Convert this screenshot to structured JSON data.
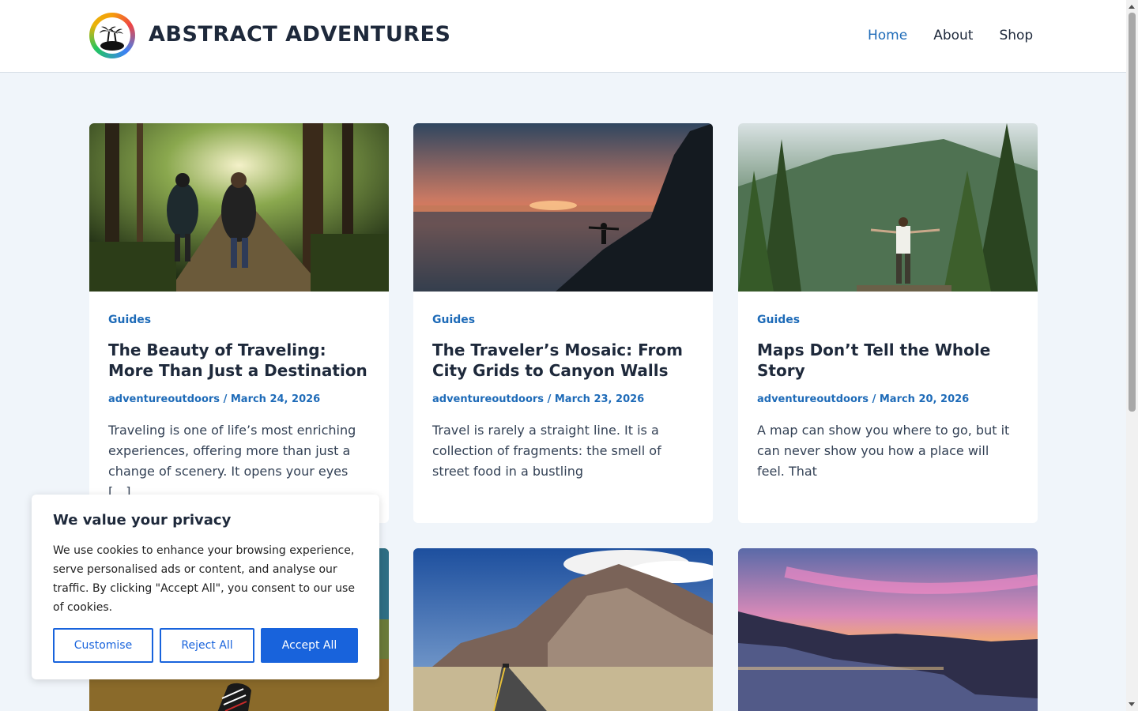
{
  "header": {
    "site_title": "ABSTRACT ADVENTURES",
    "nav": [
      {
        "label": "Home",
        "active": true
      },
      {
        "label": "About",
        "active": false
      },
      {
        "label": "Shop",
        "active": false
      }
    ]
  },
  "posts": [
    {
      "category": "Guides",
      "title": "The Beauty of Traveling: More Than Just a Destination",
      "author": "adventureoutdoors",
      "date": "March 24, 2026",
      "excerpt": "Traveling is one of life’s most enriching experiences, offering more than just a change of scenery. It opens your eyes […]",
      "image": "forest-hikers-photo"
    },
    {
      "category": "Guides",
      "title": "The Traveler’s Mosaic: From City Grids to Canyon Walls",
      "author": "adventureoutdoors",
      "date": "March 23, 2026",
      "excerpt": "Travel is rarely a straight line. It is a collection of fragments: the smell of street food in a bustling",
      "image": "ocean-sunset-cliff-photo"
    },
    {
      "category": "Guides",
      "title": "Maps Don’t Tell the Whole Story",
      "author": "adventureoutdoors",
      "date": "March 20, 2026",
      "excerpt": "A map can show you where to go, but it can never show you how a place will feel. That",
      "image": "mountain-forest-person-photo"
    },
    {
      "image": "desert-road-mountains-photo"
    },
    {
      "image": "coastal-sunset-photo"
    },
    {
      "image": "sneakers-forest-photo"
    }
  ],
  "meta_separator": " / ",
  "cookie_banner": {
    "heading": "We value your privacy",
    "text": "We use cookies to enhance your browsing experience, serve personalised ads or content, and analyse our traffic. By clicking \"Accept All\", you consent to our use of cookies.",
    "buttons": {
      "customise": "Customise",
      "reject": "Reject All",
      "accept": "Accept All"
    }
  },
  "colors": {
    "accent": "#1e6bb8",
    "background": "#f0f5fa",
    "cookie_primary": "#1863dc"
  }
}
